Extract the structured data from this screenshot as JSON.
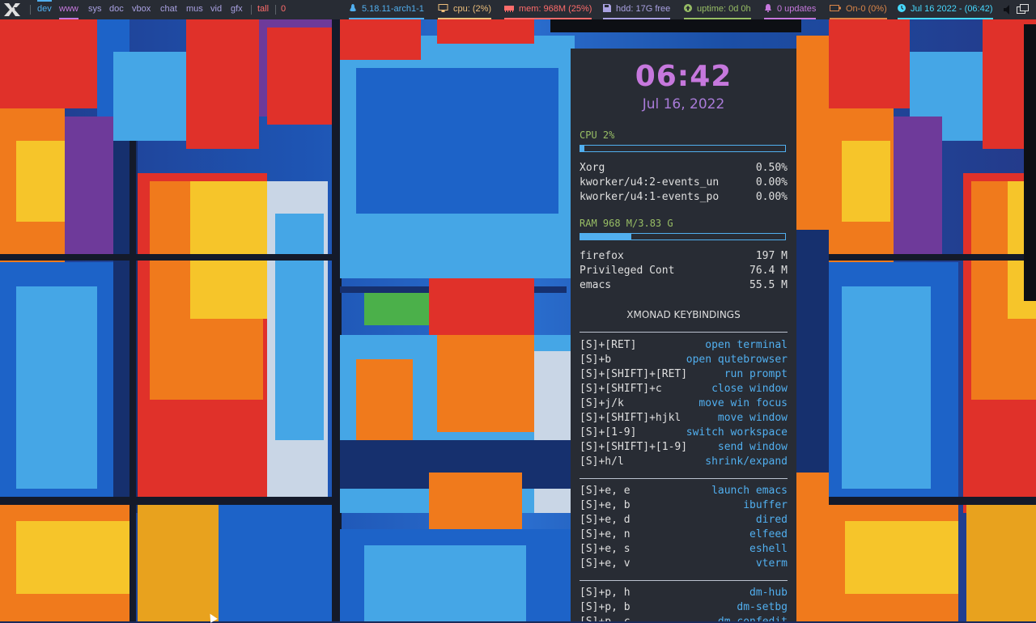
{
  "topbar": {
    "workspaces": [
      {
        "label": "dev",
        "state": "current"
      },
      {
        "label": "www",
        "state": "active"
      },
      {
        "label": "sys",
        "state": ""
      },
      {
        "label": "doc",
        "state": ""
      },
      {
        "label": "vbox",
        "state": ""
      },
      {
        "label": "chat",
        "state": ""
      },
      {
        "label": "mus",
        "state": ""
      },
      {
        "label": "vid",
        "state": ""
      },
      {
        "label": "gfx",
        "state": ""
      }
    ],
    "layout": "tall",
    "window_count": "0",
    "kernel": "5.18.11-arch1-1",
    "cpu": "cpu: (2%)",
    "mem": "mem: 968M (25%)",
    "hdd": "hdd: 17G free",
    "uptime": "uptime: 0d 0h",
    "updates": "0 updates",
    "battery": "On-0 (0%)",
    "datetime": "Jul 16 2022 - (06:42)",
    "colors": {
      "kernel": "#51afef",
      "cpu": "#ecbe7b",
      "mem": "#ff6c6b",
      "hdd": "#a9a1e1",
      "uptime": "#98be65",
      "updates": "#c678dd",
      "battery": "#da8548",
      "datetime": "#46d9ff"
    }
  },
  "conky": {
    "time": "06:42",
    "date": "Jul 16, 2022",
    "cpu": {
      "label": "CPU  2%",
      "percent": 2
    },
    "cpu_procs": [
      {
        "name": "Xorg",
        "value": "0.50%"
      },
      {
        "name": "kworker/u4:2-events_un",
        "value": "0.00%"
      },
      {
        "name": "kworker/u4:1-events_po",
        "value": "0.00%"
      }
    ],
    "ram": {
      "label": "RAM  968 M/3.83 G",
      "percent": 25
    },
    "ram_procs": [
      {
        "name": "firefox",
        "value": "197 M"
      },
      {
        "name": "Privileged Cont",
        "value": "76.4 M"
      },
      {
        "name": "emacs",
        "value": "55.5 M"
      }
    ],
    "keybindings_title": "XMONAD KEYBINDINGS",
    "keybindings_group1": [
      {
        "keys": "[S]+[RET]",
        "action": "open terminal"
      },
      {
        "keys": "[S]+b",
        "action": "open qutebrowser"
      },
      {
        "keys": "[S]+[SHIFT]+[RET]",
        "action": "run prompt"
      },
      {
        "keys": "[S]+[SHIFT]+c",
        "action": "close window"
      },
      {
        "keys": "[S]+j/k",
        "action": "move win focus"
      },
      {
        "keys": "[S]+[SHIFT]+hjkl",
        "action": "move window"
      },
      {
        "keys": "[S]+[1-9]",
        "action": "switch workspace"
      },
      {
        "keys": "[S]+[SHIFT]+[1-9]",
        "action": "send window"
      },
      {
        "keys": "[S]+h/l",
        "action": "shrink/expand"
      }
    ],
    "keybindings_group2": [
      {
        "keys": "[S]+e, e",
        "action": "launch emacs"
      },
      {
        "keys": "[S]+e, b",
        "action": "ibuffer"
      },
      {
        "keys": "[S]+e, d",
        "action": "dired"
      },
      {
        "keys": "[S]+e, n",
        "action": "elfeed"
      },
      {
        "keys": "[S]+e, s",
        "action": "eshell"
      },
      {
        "keys": "[S]+e, v",
        "action": "vterm"
      }
    ],
    "keybindings_group3": [
      {
        "keys": "[S]+p, h",
        "action": "dm-hub"
      },
      {
        "keys": "[S]+p, b",
        "action": "dm-setbg"
      },
      {
        "keys": "[S]+p, c",
        "action": "dm-confedit"
      }
    ]
  }
}
